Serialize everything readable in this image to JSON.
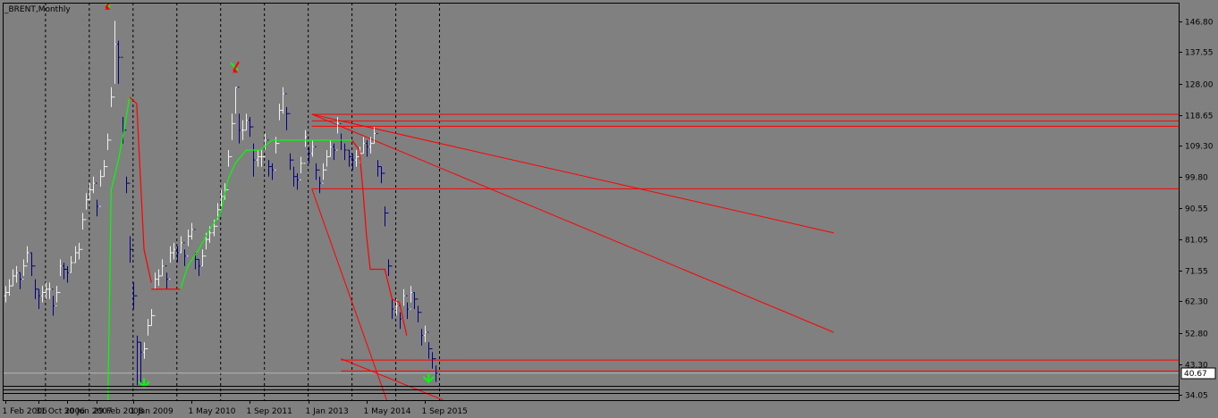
{
  "window": {
    "title": "_BRENT,Monthly",
    "background": "#808080",
    "axis_color": "#000000"
  },
  "chart_data": {
    "type": "ohlc",
    "title": "_BRENT,Monthly",
    "symbol": "_BRENT",
    "timeframe": "Monthly",
    "ylim": [
      32.5,
      152.5
    ],
    "y_ticks": [
      "146.80",
      "137.55",
      "128.00",
      "118.65",
      "109.30",
      "99.80",
      "90.55",
      "81.05",
      "71.55",
      "62.30",
      "52.80",
      "43.30",
      "34.05"
    ],
    "y_tick_values": [
      146.8,
      137.55,
      128.0,
      118.65,
      109.3,
      99.8,
      90.55,
      81.05,
      71.55,
      62.3,
      52.8,
      43.3,
      34.05
    ],
    "current_price": "40.67",
    "current_price_value": 40.67,
    "x_ticks": [
      "1 Feb 2006",
      "31 Oct 2006",
      "30 Jun 2007",
      "29 Feb 2008",
      "1 Jan 2009",
      "1 May 2010",
      "1 Sep 2011",
      "1 Jan 2013",
      "1 May 2014",
      "1 Sep 2015"
    ],
    "x_tick_month_index": [
      0,
      9,
      17,
      25,
      35,
      51,
      67,
      83,
      99,
      115
    ],
    "period_separator_month_index": [
      11,
      23,
      35,
      47,
      59,
      71,
      83,
      95,
      107,
      119
    ],
    "first_month": "Feb 2006",
    "close": [
      65,
      67,
      70,
      71,
      69,
      73,
      77,
      73,
      66,
      64,
      65,
      66,
      66,
      61,
      65,
      73,
      72,
      71,
      74,
      77,
      78,
      87,
      93,
      96,
      98,
      91,
      100,
      103,
      111,
      124,
      140,
      136,
      114,
      98,
      78,
      64,
      50,
      47,
      48,
      55,
      58,
      69,
      70,
      73,
      69,
      77,
      78,
      77,
      80,
      76,
      82,
      84,
      75,
      73,
      76,
      81,
      83,
      85,
      90,
      94,
      96,
      106,
      116,
      127,
      114,
      114,
      117,
      115,
      105,
      106,
      106,
      111,
      103,
      102,
      110,
      120,
      125,
      119,
      105,
      100,
      99,
      104,
      112,
      107,
      109,
      102,
      98,
      102,
      106,
      109,
      108,
      116,
      111,
      108,
      106,
      105,
      106,
      107,
      110,
      109,
      110,
      113,
      103,
      101,
      89,
      73,
      60,
      61,
      57,
      64,
      60,
      65,
      63,
      59,
      52,
      53,
      48,
      45,
      40.67
    ],
    "high": [
      67,
      69,
      72,
      73,
      71,
      75,
      79,
      77,
      69,
      66,
      67,
      68,
      68,
      64,
      67,
      75,
      74,
      73,
      76,
      79,
      80,
      89,
      95,
      98,
      100,
      93,
      102,
      105,
      113,
      127,
      147,
      141,
      118,
      100,
      82,
      68,
      52,
      50,
      50,
      57,
      60,
      71,
      72,
      75,
      71,
      79,
      80,
      79,
      82,
      78,
      84,
      86,
      77,
      75,
      78,
      83,
      85,
      87,
      92,
      96,
      98,
      108,
      119,
      127,
      119,
      117,
      119,
      118,
      110,
      108,
      108,
      113,
      105,
      104,
      112,
      122,
      127,
      121,
      107,
      103,
      101,
      106,
      114,
      109,
      111,
      104,
      100,
      104,
      108,
      111,
      110,
      118,
      113,
      110,
      108,
      107,
      108,
      109,
      112,
      111,
      112,
      115,
      105,
      103,
      91,
      75,
      63,
      63,
      59,
      66,
      62,
      67,
      65,
      61,
      54,
      55,
      50,
      47,
      43
    ],
    "low": [
      62,
      64,
      67,
      68,
      66,
      70,
      74,
      70,
      63,
      60,
      62,
      63,
      63,
      58,
      62,
      70,
      69,
      68,
      71,
      74,
      75,
      84,
      90,
      93,
      95,
      88,
      97,
      100,
      108,
      121,
      128,
      128,
      110,
      95,
      74,
      60,
      37,
      37,
      45,
      52,
      55,
      66,
      67,
      70,
      66,
      74,
      75,
      74,
      77,
      73,
      79,
      81,
      72,
      70,
      73,
      78,
      80,
      82,
      87,
      91,
      93,
      103,
      111,
      119,
      110,
      111,
      114,
      112,
      100,
      103,
      103,
      108,
      100,
      99,
      107,
      117,
      119,
      114,
      102,
      97,
      96,
      101,
      109,
      104,
      106,
      99,
      95,
      99,
      103,
      106,
      105,
      113,
      108,
      105,
      103,
      102,
      103,
      104,
      107,
      106,
      107,
      110,
      100,
      98,
      85,
      70,
      57,
      58,
      54,
      61,
      57,
      62,
      60,
      56,
      49,
      50,
      45,
      42,
      38
    ],
    "lines": {
      "horizontal_levels": [
        118.8,
        116.8,
        115.2,
        96.3,
        44.6,
        41.3
      ],
      "trend_lines": [
        {
          "from_month": 84,
          "from_price": 118.8,
          "to_month": 227,
          "to_price": 83.0,
          "color": "#ff0000"
        },
        {
          "from_month": 84,
          "from_price": 118.8,
          "to_month": 227,
          "to_price": 53.0,
          "color": "#ff0000"
        },
        {
          "from_month": 84,
          "from_price": 96.3,
          "to_month": 105,
          "to_price": 31.0,
          "color": "#ff0000"
        },
        {
          "from_month": 92,
          "from_price": 45.0,
          "to_month": 120,
          "to_price": 32.5,
          "color": "#ff0000"
        }
      ],
      "level_start_month": 84,
      "level_44_start_month": 92,
      "current_price_line_color": "#b4b4b4"
    },
    "supertrend": {
      "up_color": "#00ff00",
      "down_color": "#ff0000",
      "up": [
        [
          28,
          25
        ],
        [
          29,
          96
        ],
        [
          31,
          105
        ],
        [
          33,
          117
        ],
        [
          34,
          124
        ]
      ],
      "down": [
        [
          34,
          124
        ],
        [
          36,
          122
        ],
        [
          37,
          100
        ],
        [
          38,
          78
        ],
        [
          39,
          73
        ],
        [
          40,
          68
        ]
      ],
      "down2": [
        [
          40,
          66
        ],
        [
          48,
          66
        ]
      ],
      "up2": [
        [
          48,
          66
        ],
        [
          50,
          73
        ],
        [
          53,
          78
        ],
        [
          56,
          84
        ],
        [
          59,
          89
        ],
        [
          61,
          99
        ],
        [
          63,
          104
        ],
        [
          66,
          108
        ],
        [
          70,
          108
        ],
        [
          73,
          111
        ],
        [
          79,
          111
        ],
        [
          95,
          111
        ]
      ],
      "down3": [
        [
          95,
          111
        ],
        [
          97,
          108
        ],
        [
          98,
          96
        ],
        [
          99,
          82
        ],
        [
          100,
          72
        ],
        [
          104,
          72
        ],
        [
          106,
          63
        ],
        [
          108,
          62
        ],
        [
          110,
          52
        ]
      ]
    },
    "arrows": [
      {
        "month": 28,
        "price": 152,
        "dir": "down",
        "color": "#ff0000"
      },
      {
        "month": 63,
        "price": 133,
        "dir": "down",
        "color": "#ff0000"
      },
      {
        "month": 38,
        "price": 37,
        "dir": "up",
        "color": "#00ff00"
      },
      {
        "month": 116,
        "price": 38.5,
        "dir": "up",
        "color": "#00ff00"
      }
    ],
    "bar_color_up": "#f0f0f0",
    "bar_color_down": "#000080",
    "grid": false
  }
}
